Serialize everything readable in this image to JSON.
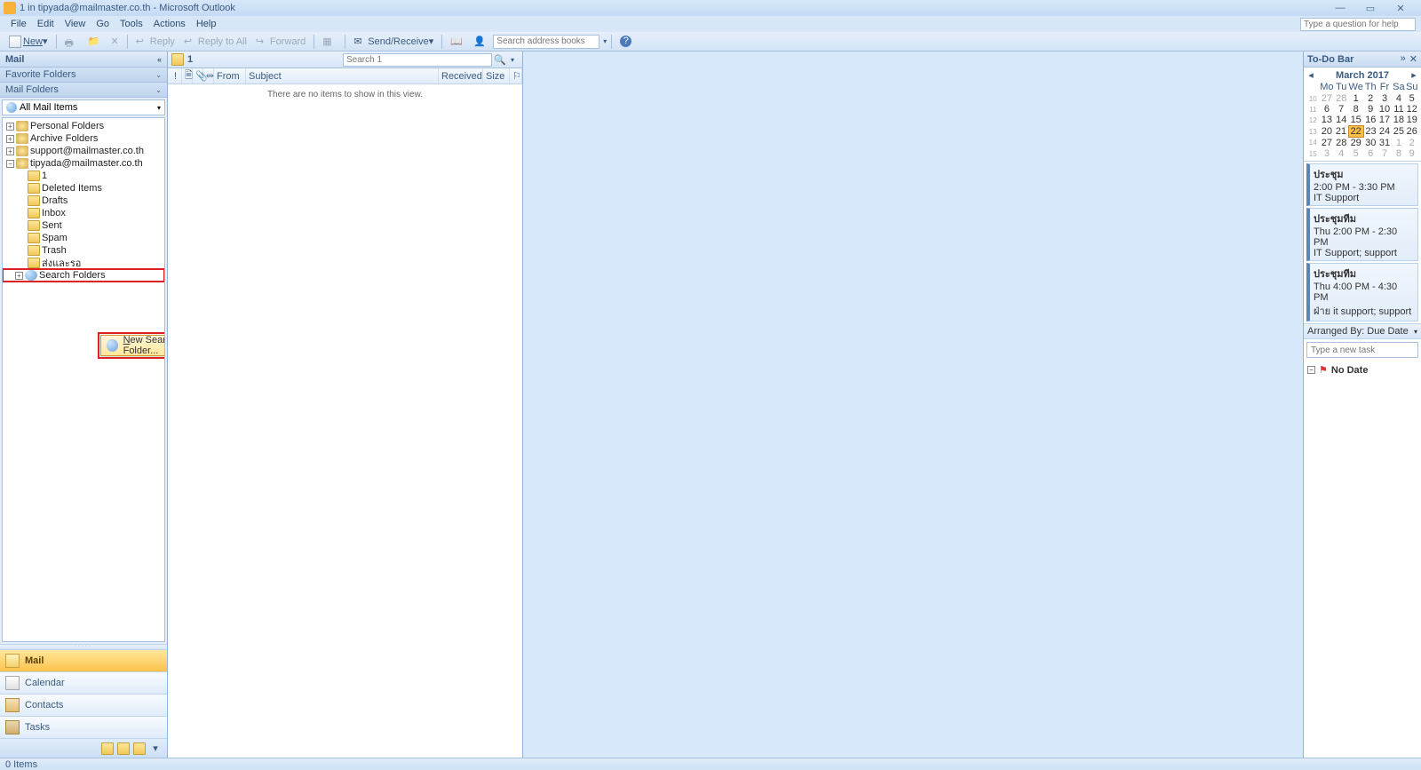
{
  "window": {
    "title": "1 in tipyada@mailmaster.co.th - Microsoft Outlook"
  },
  "menu": {
    "items": [
      "File",
      "Edit",
      "View",
      "Go",
      "Tools",
      "Actions",
      "Help"
    ],
    "help_placeholder": "Type a question for help"
  },
  "toolbar": {
    "new": "New",
    "reply": "Reply",
    "reply_all": "Reply to All",
    "forward": "Forward",
    "send_receive": "Send/Receive",
    "search_books_placeholder": "Search address books"
  },
  "nav": {
    "header": "Mail",
    "favorite_label": "Favorite Folders",
    "mailfolders_label": "Mail Folders",
    "dropdown": "All Mail Items",
    "tree": {
      "roots": [
        {
          "label": "Personal Folders",
          "exp": "+"
        },
        {
          "label": "Archive Folders",
          "exp": "+"
        },
        {
          "label": "support@mailmaster.co.th",
          "exp": "+"
        },
        {
          "label": "tipyada@mailmaster.co.th",
          "exp": "−"
        }
      ],
      "children": [
        "1",
        "Deleted Items",
        "Drafts",
        "Inbox",
        "Sent",
        "Spam",
        "Trash",
        "ส่งและรอ"
      ],
      "search_folders": "Search Folders"
    },
    "context_menu": {
      "label": "New Search Folder...",
      "underline": "N"
    },
    "buttons": {
      "mail": "Mail",
      "calendar": "Calendar",
      "contacts": "Contacts",
      "tasks": "Tasks"
    }
  },
  "list": {
    "folder_title": "1",
    "search_placeholder": "Search 1",
    "columns": {
      "from": "From",
      "subject": "Subject",
      "received": "Received",
      "size": "Size"
    },
    "empty": "There are no items to show in this view."
  },
  "todo": {
    "header": "To-Do Bar",
    "month": "March 2017",
    "dow": [
      "Mo",
      "Tu",
      "We",
      "Th",
      "Fr",
      "Sa",
      "Su"
    ],
    "weeks": [
      {
        "wk": "10",
        "d": [
          "27",
          "28",
          "1",
          "2",
          "3",
          "4",
          "5"
        ],
        "dim": [
          0,
          1
        ]
      },
      {
        "wk": "11",
        "d": [
          "6",
          "7",
          "8",
          "9",
          "10",
          "11",
          "12"
        ],
        "dim": []
      },
      {
        "wk": "12",
        "d": [
          "13",
          "14",
          "15",
          "16",
          "17",
          "18",
          "19"
        ],
        "dim": []
      },
      {
        "wk": "13",
        "d": [
          "20",
          "21",
          "22",
          "23",
          "24",
          "25",
          "26"
        ],
        "dim": [],
        "today": 2
      },
      {
        "wk": "14",
        "d": [
          "27",
          "28",
          "29",
          "30",
          "31",
          "1",
          "2"
        ],
        "dim": [
          5,
          6
        ]
      },
      {
        "wk": "15",
        "d": [
          "3",
          "4",
          "5",
          "6",
          "7",
          "8",
          "9"
        ],
        "dim": [
          0,
          1,
          2,
          3,
          4,
          5,
          6
        ]
      }
    ],
    "appointments": [
      {
        "title": "ประชุม",
        "time": "2:00 PM - 3:30 PM",
        "loc": "IT Support"
      },
      {
        "title": "ประชุมทีม",
        "time": "Thu 2:00 PM - 2:30 PM",
        "loc": "IT Support; support"
      },
      {
        "title": "ประชุมทีม",
        "time": "Thu 4:00 PM - 4:30 PM",
        "loc": "ฝ่าย it support; support"
      }
    ],
    "arranged": "Arranged By: Due Date",
    "newtask_placeholder": "Type a new task",
    "nodate": "No Date"
  },
  "status": {
    "items": "0 Items"
  }
}
